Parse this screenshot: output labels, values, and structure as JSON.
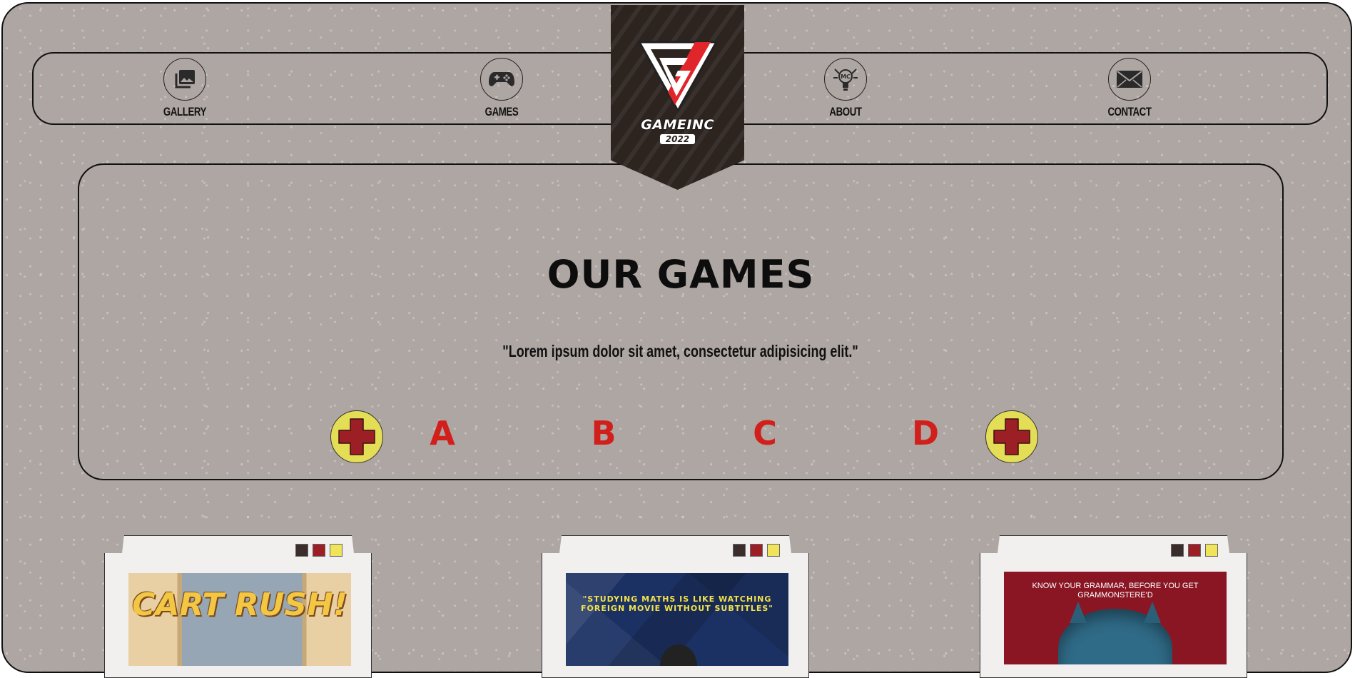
{
  "nav": {
    "items": [
      {
        "label": "GALLERY",
        "icon": "gallery-icon"
      },
      {
        "label": "GAMES",
        "icon": "gamepad-icon"
      },
      {
        "label": "ABOUT",
        "icon": "mascot-icon"
      },
      {
        "label": "CONTACT",
        "icon": "mail-icon"
      }
    ]
  },
  "logo": {
    "name": "GAMEINC",
    "sub": "2022",
    "icon": "triangle-g-logo-icon"
  },
  "hero": {
    "title": "OUR GAMES",
    "quote": "\"Lorem ipsum dolor sit amet, consectetur adipisicing elit.\"",
    "letters": [
      "A",
      "B",
      "C",
      "D"
    ],
    "dpad_icon": "dpad-icon"
  },
  "colors": {
    "background": "#aea6a3",
    "banner": "#2d2420",
    "accent_red": "#d11f1c",
    "accent_yellow": "#e4dd56",
    "card": "#f1f0ef"
  },
  "cards": [
    {
      "title_art": "CART RUSH!",
      "swatches": [
        "#3a2d2b",
        "#9c1f26",
        "#f0e45a"
      ]
    },
    {
      "quote_line1": "\"STUDYING MATHS IS LIKE WATCHING",
      "quote_line2": "FOREIGN MOVIE WITHOUT SUBTITLES\"",
      "swatches": [
        "#3a2d2b",
        "#9c1f26",
        "#f0e45a"
      ]
    },
    {
      "quote_line1": "KNOW YOUR GRAMMAR, BEFORE YOU GET",
      "quote_line2": "GRAMMONSTERE'D",
      "swatches": [
        "#3a2d2b",
        "#9c1f26",
        "#f0e45a"
      ]
    }
  ]
}
